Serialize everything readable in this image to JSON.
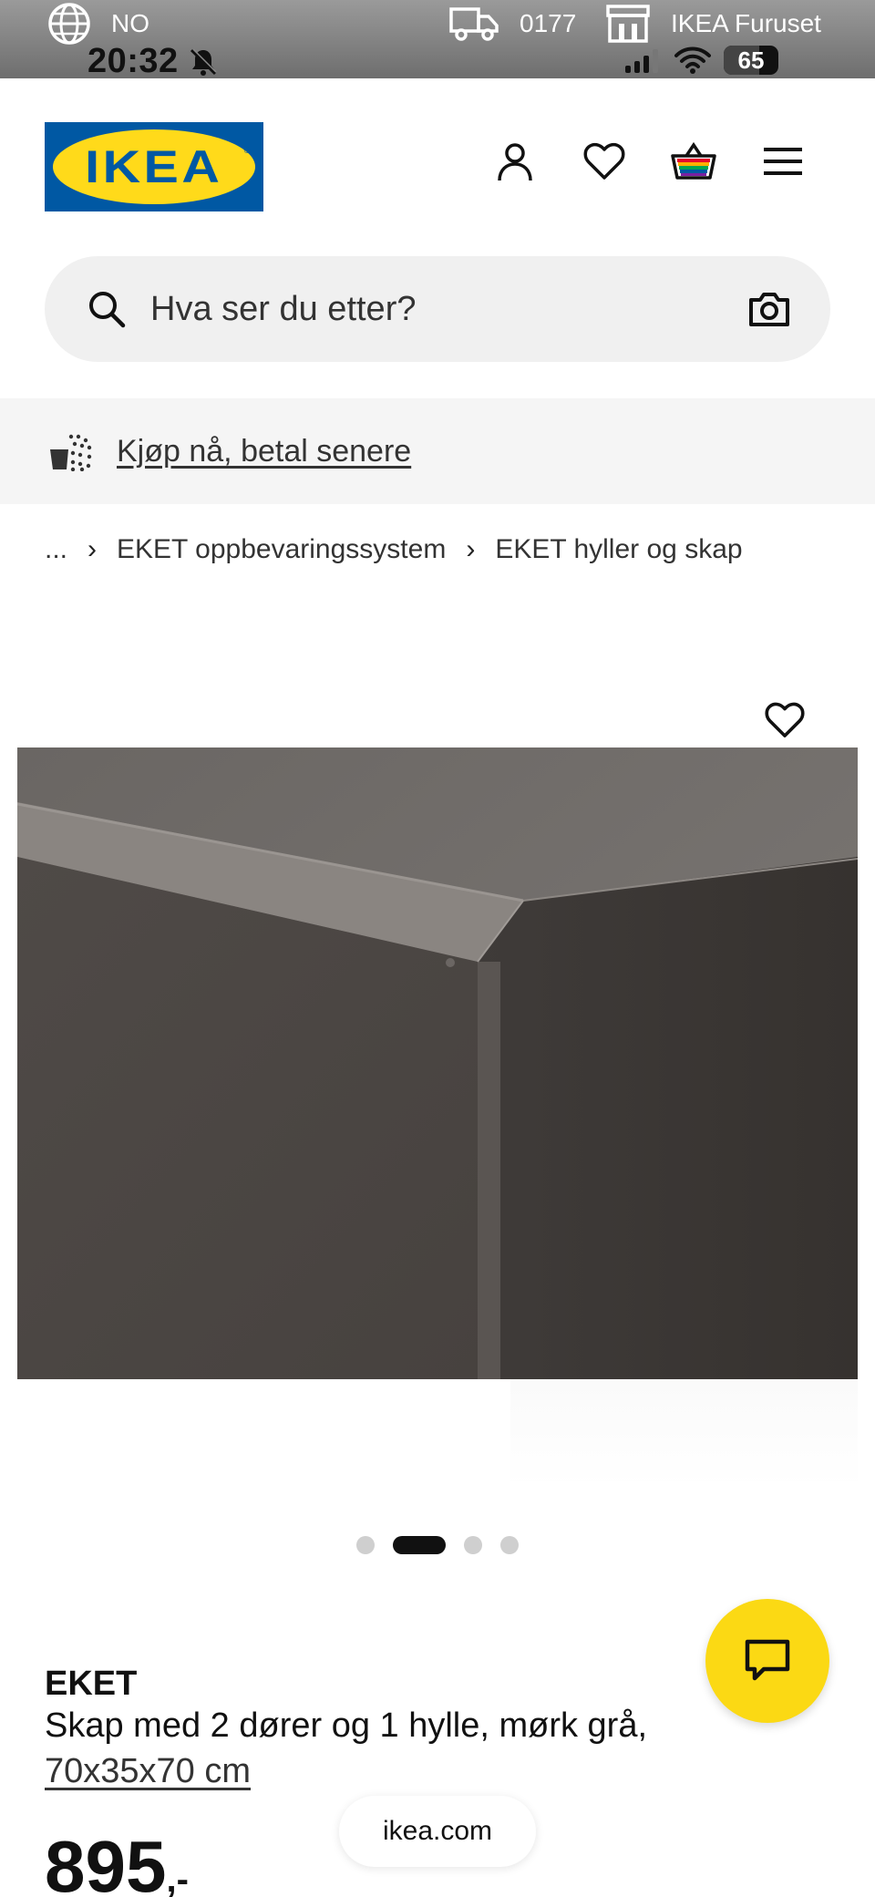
{
  "topbar": {
    "language": "NO",
    "delivery_code": "0177",
    "store": "IKEA Furuset",
    "time": "20:32",
    "battery": "65"
  },
  "header": {
    "logo_text": "IKEA",
    "logo_mark": "®",
    "icons": [
      "user-icon",
      "heart-icon",
      "basket-icon",
      "menu-icon"
    ]
  },
  "search": {
    "placeholder": "Hva ser du etter?"
  },
  "promo": {
    "link": "Kjøp nå, betal senere"
  },
  "breadcrumb": {
    "items": [
      "...",
      "EKET oppbevaringssystem",
      "EKET hyller og skap"
    ]
  },
  "gallery": {
    "slide_count": 4,
    "active_slide": 2
  },
  "product": {
    "brand": "EKET",
    "description": "Skap med 2 dører og 1 hylle, mørk grå,",
    "dimensions": "70x35x70 cm",
    "price": "895",
    "price_suffix": ",-"
  },
  "browser": {
    "url": "ikea.com"
  },
  "colors": {
    "brand_blue": "#0058a3",
    "brand_yellow": "#ffda1a",
    "chat_yellow": "#fbd914",
    "product_grey": "#55504c"
  }
}
